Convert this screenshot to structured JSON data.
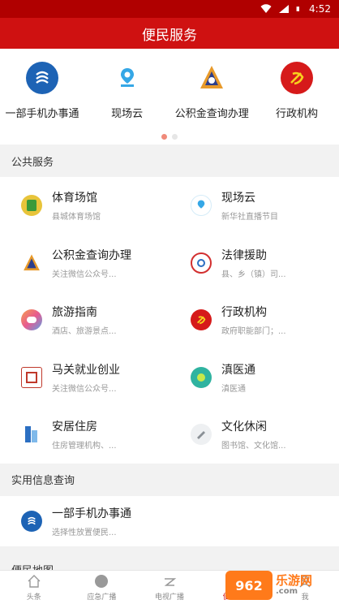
{
  "status_bar": {
    "time": "4:52"
  },
  "header": {
    "title": "便民服务"
  },
  "carousel": {
    "items": [
      {
        "label": "一部手机办事通",
        "icon": "yibu-app-icon"
      },
      {
        "label": "现场云",
        "icon": "xianchangyun-icon"
      },
      {
        "label": "公积金查询办理",
        "icon": "gongjijin-icon"
      },
      {
        "label": "行政机构",
        "icon": "party-emblem-icon"
      }
    ],
    "page_count": 2,
    "active_page": 1
  },
  "public_services": {
    "title": "公共服务",
    "items": [
      {
        "title": "体育场馆",
        "subtitle": "县城体育场馆",
        "icon": "stadium-icon",
        "color": "#e8c43a"
      },
      {
        "title": "现场云",
        "subtitle": "新华社直播节目",
        "icon": "xianchangyun-icon",
        "color": "#35a7e6"
      },
      {
        "title": "公积金查询办理",
        "subtitle": "关注微信公众号...",
        "icon": "gongjijin-icon",
        "color": "#2c3e8c"
      },
      {
        "title": "法律援助",
        "subtitle": "县、乡（镇）司...",
        "icon": "legal-aid-icon",
        "color": "#d22f2f"
      },
      {
        "title": "旅游指南",
        "subtitle": "酒店、旅游景点...",
        "icon": "travel-icon",
        "color": "#f28b3c"
      },
      {
        "title": "行政机构",
        "subtitle": "政府职能部门；...",
        "icon": "party-emblem-icon",
        "color": "#d61a1a"
      },
      {
        "title": "马关就业创业",
        "subtitle": "关注微信公众号...",
        "icon": "employment-icon",
        "color": "#c0392b"
      },
      {
        "title": "滇医通",
        "subtitle": "滇医通",
        "icon": "dianyitong-icon",
        "color": "#2fb3a0"
      },
      {
        "title": "安居住房",
        "subtitle": "住房管理机构、...",
        "icon": "housing-icon",
        "color": "#3b8fd6"
      },
      {
        "title": "文化休闲",
        "subtitle": "图书馆、文化馆...",
        "icon": "culture-icon",
        "color": "#9aa0a6"
      }
    ]
  },
  "info_query": {
    "title": "实用信息查询",
    "items": [
      {
        "title": "一部手机办事通",
        "subtitle": "选择性放置便民...",
        "icon": "yibu-app-icon",
        "color": "#1d63b5"
      }
    ]
  },
  "next_section": {
    "title": "便民地图"
  },
  "tabbar": {
    "tabs": [
      {
        "label": "头条",
        "icon": "home-icon"
      },
      {
        "label": "应急广播",
        "icon": "broadcast-icon"
      },
      {
        "label": "电视广播",
        "icon": "tv-icon"
      },
      {
        "label": "便民服务",
        "icon": "service-icon",
        "active": true
      },
      {
        "label": "我",
        "icon": "user-icon"
      }
    ]
  },
  "watermark": {
    "logo": "962",
    "text": "乐游网",
    "site": ".com"
  }
}
